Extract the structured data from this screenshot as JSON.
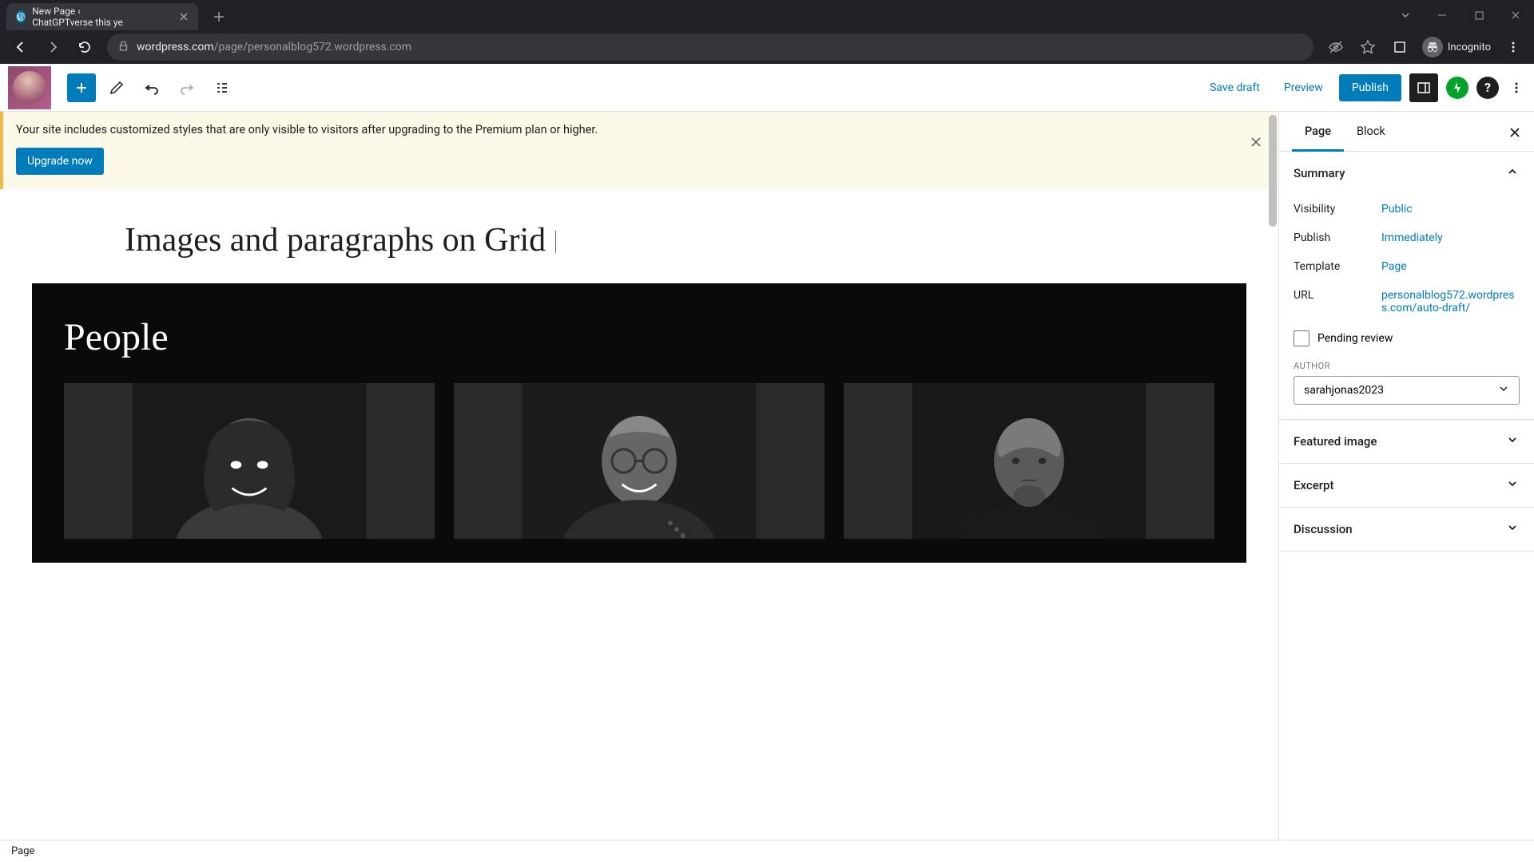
{
  "browser": {
    "tab_title": "New Page ‹ ChatGPTverse this ye",
    "url_domain": "wordpress.com",
    "url_path": "/page/personalblog572.wordpress.com",
    "incognito_label": "Incognito"
  },
  "editor_bar": {
    "save_draft": "Save draft",
    "preview": "Preview",
    "publish": "Publish"
  },
  "notice": {
    "text": "Your site includes customized styles that are only visible to visitors after upgrading to the Premium plan or higher.",
    "button": "Upgrade now"
  },
  "page": {
    "title": "Images and paragraphs on Grid",
    "grid_heading": "People"
  },
  "sidebar": {
    "tabs": {
      "page": "Page",
      "block": "Block"
    },
    "summary": {
      "heading": "Summary",
      "rows": {
        "visibility_label": "Visibility",
        "visibility_value": "Public",
        "publish_label": "Publish",
        "publish_value": "Immediately",
        "template_label": "Template",
        "template_value": "Page",
        "url_label": "URL",
        "url_value": "personalblog572.wordpress.com/auto-draft/"
      },
      "pending_review": "Pending review",
      "author_label": "AUTHOR",
      "author_value": "sarahjonas2023"
    },
    "featured_image": "Featured image",
    "excerpt": "Excerpt",
    "discussion": "Discussion"
  },
  "footer": {
    "breadcrumb": "Page"
  }
}
